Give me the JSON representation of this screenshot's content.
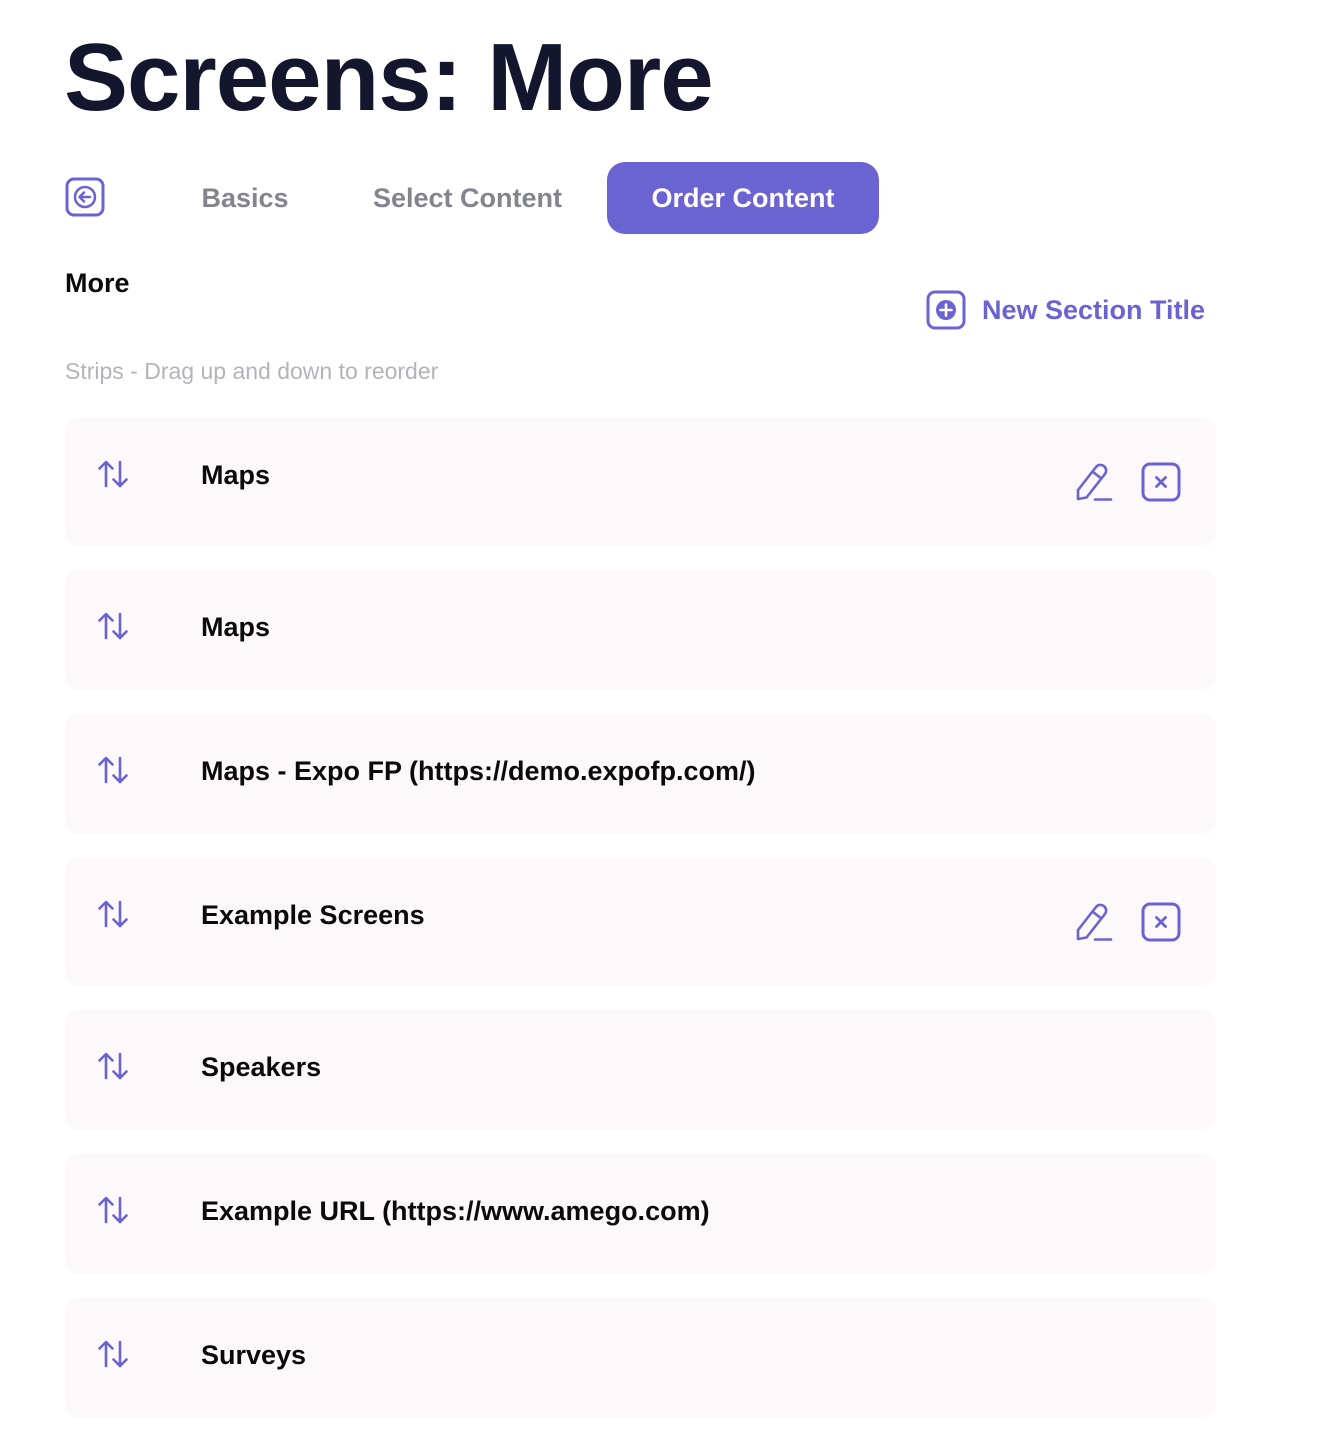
{
  "page": {
    "title": "Screens: More"
  },
  "tabs": {
    "basics": "Basics",
    "select_content": "Select Content",
    "order_content": "Order Content",
    "active": "order_content"
  },
  "section": {
    "title": "More",
    "new_section_label": "New Section Title",
    "hint": "Strips - Drag up and down to reorder"
  },
  "strips": [
    {
      "label": "Maps",
      "editable": true
    },
    {
      "label": "Maps",
      "editable": false
    },
    {
      "label": "Maps - Expo FP (https://demo.expofp.com/)",
      "editable": false
    },
    {
      "label": "Example Screens",
      "editable": true
    },
    {
      "label": "Speakers",
      "editable": false
    },
    {
      "label": "Example URL (https://www.amego.com)",
      "editable": false
    },
    {
      "label": "Surveys",
      "editable": false
    }
  ],
  "icons": {
    "back": "arrow-left-icon",
    "add": "plus-square-icon",
    "drag": "sort-arrows-icon",
    "edit": "pencil-icon",
    "remove": "x-square-icon"
  },
  "colors": {
    "accent": "#6b63d1",
    "title": "#14162e",
    "muted": "#83848f",
    "hint": "#b3b3bb",
    "strip_bg": "#fdf9fb"
  }
}
